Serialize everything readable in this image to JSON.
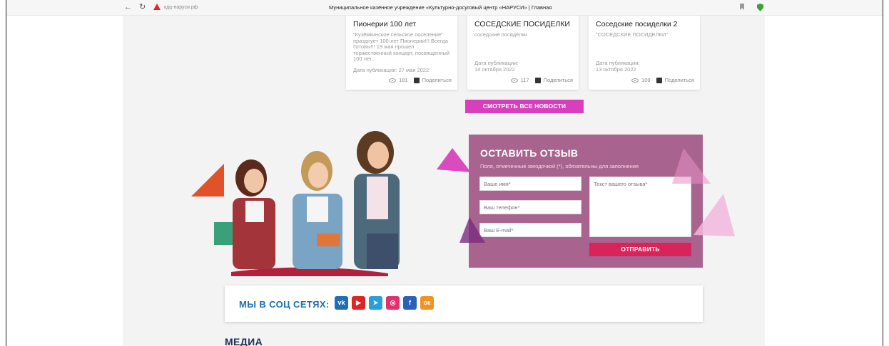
{
  "browser": {
    "back_icon": "←",
    "reload_icon": "↻",
    "url": "кдц-наруси.рф",
    "tab_title": "Муниципальное казённое учреждение «Культурно-досуговый центр «НАРУСИ» | Главная"
  },
  "news_cards": [
    {
      "title": "Пионерии 100 лет",
      "text": "\"Кузёмкинское сельское поселение\" празднует 100-лет Пионерии!!! Всегда Готовы!!! 19 мая прошел торжественный концерт, посвященный 100 лет...",
      "date": "Дата публикации: 27 мая 2022",
      "views": "181",
      "share_label": "Поделиться"
    },
    {
      "title": "СОСЕДСКИЕ ПОСИДЕЛКИ",
      "text": "соседские посиделки",
      "date": "Дата публикации:\n14 октября 2022",
      "views": "117",
      "share_label": "Поделиться"
    },
    {
      "title": "Соседские посиделки 2",
      "text": "\"СОСЕДСКИЕ ПОСИДЕЛКИ\"",
      "date": "Дата публикации:\n13 октября 2022",
      "views": "109",
      "share_label": "Поделиться"
    }
  ],
  "all_news_button": "СМОТРЕТЬ ВСЕ НОВОСТИ",
  "feedback_form": {
    "title": "ОСТАВИТЬ ОТЗЫВ",
    "hint": "Поля, отмеченные звездочкой (*), обязательны для заполнения",
    "name_placeholder": "Ваше имя*",
    "phone_placeholder": "Ваш телефон*",
    "email_placeholder": "Ваш E-mail*",
    "message_placeholder": "Текст вашего отзыва*",
    "submit_label": "ОТПРАВИТЬ"
  },
  "social": {
    "label": "МЫ В СОЦ СЕТЯХ:",
    "icons": [
      {
        "name": "vk-icon",
        "glyph": "vk",
        "color": "#1e6fb3"
      },
      {
        "name": "youtube-icon",
        "glyph": "▶",
        "color": "#e02424"
      },
      {
        "name": "telegram-icon",
        "glyph": "➤",
        "color": "#2b9fd9"
      },
      {
        "name": "instagram-icon",
        "glyph": "◎",
        "color": "#e1306c"
      },
      {
        "name": "facebook-icon",
        "glyph": "f",
        "color": "#2b62b8"
      },
      {
        "name": "odnoklassniki-icon",
        "glyph": "ок",
        "color": "#f29220"
      }
    ]
  },
  "media_heading": "МЕДИА",
  "colors": {
    "accent_pink": "#d83fbd",
    "form_bg": "#a8648e",
    "submit_red": "#d8245a",
    "social_blue": "#1e6fb3"
  }
}
